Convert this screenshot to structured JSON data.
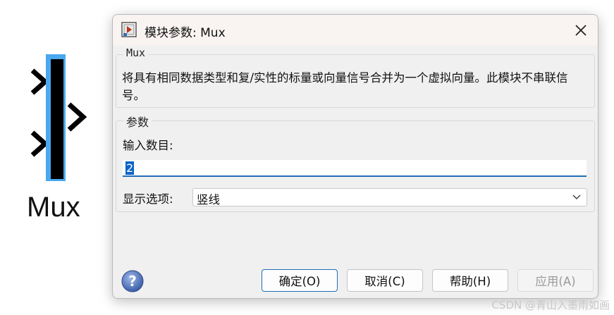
{
  "canvas": {
    "block_name": "Mux"
  },
  "dialog": {
    "title": "模块参数: Mux",
    "description_legend": "Mux",
    "description_text": "将具有相同数据类型和复/实性的标量或向量信号合并为一个虚拟向量。此模块不串联信号。",
    "params_legend": "参数",
    "num_inputs_label": "输入数目:",
    "num_inputs_value": "2",
    "display_option_label": "显示选项:",
    "display_option_value": "竖线",
    "buttons": {
      "ok": "确定(O)",
      "cancel": "取消(C)",
      "help": "帮助(H)",
      "apply": "应用(A)"
    }
  },
  "watermark": "CSDN @青山入墨雨如画",
  "colors": {
    "accent": "#1f6fb5",
    "selection": "#4aa8ee"
  }
}
